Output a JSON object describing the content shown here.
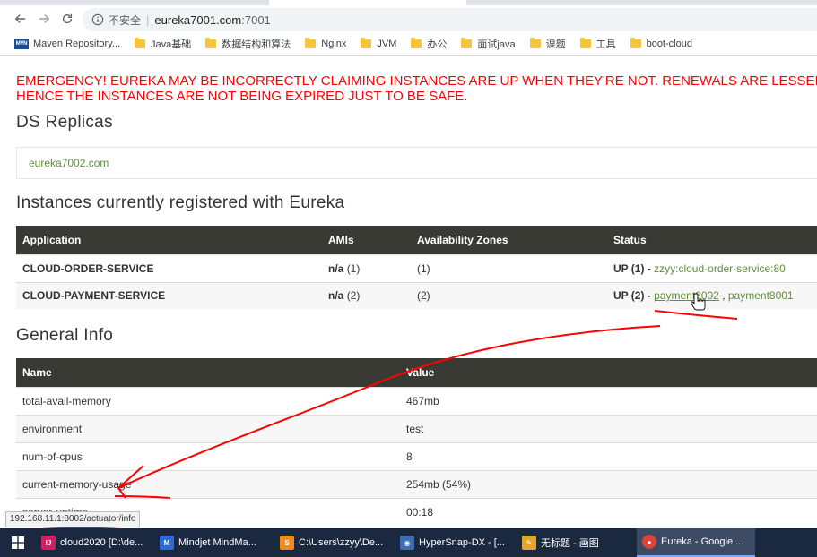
{
  "browser": {
    "omnibox": {
      "security_label": "不安全",
      "url_host": "eureka7001.com",
      "url_port": ":7001"
    },
    "bookmarks": [
      {
        "label": "Maven Repository...",
        "icon": "maven-logo"
      },
      {
        "label": "Java基础",
        "icon": "folder-icon"
      },
      {
        "label": "数据结构和算法",
        "icon": "folder-icon"
      },
      {
        "label": "Nginx",
        "icon": "folder-icon"
      },
      {
        "label": "JVM",
        "icon": "folder-icon"
      },
      {
        "label": "办公",
        "icon": "folder-icon"
      },
      {
        "label": "面试java",
        "icon": "folder-icon"
      },
      {
        "label": "课题",
        "icon": "folder-icon"
      },
      {
        "label": "工具",
        "icon": "folder-icon"
      },
      {
        "label": "boot-cloud",
        "icon": "folder-icon"
      }
    ],
    "status_url": "192.168.11.1:8002/actuator/info"
  },
  "page": {
    "emergency_line1": "EMERGENCY! EUREKA MAY BE INCORRECTLY CLAIMING INSTANCES ARE UP WHEN THEY'RE NOT. RENEWALS ARE LESSER",
    "emergency_line2": "HENCE THE INSTANCES ARE NOT BEING EXPIRED JUST TO BE SAFE.",
    "ds_replicas_title": "DS Replicas",
    "replica": "eureka7002.com",
    "instances_title": "Instances currently registered with Eureka",
    "instances_headers": [
      "Application",
      "AMIs",
      "Availability Zones",
      "Status"
    ],
    "instances": [
      {
        "application": "CLOUD-ORDER-SERVICE",
        "amis_value": "n/a",
        "amis_count": "(1)",
        "zones": "(1)",
        "status_prefix": "UP (1) - ",
        "links": [
          "zzyy:cloud-order-service:80"
        ]
      },
      {
        "application": "CLOUD-PAYMENT-SERVICE",
        "amis_value": "n/a",
        "amis_count": "(2)",
        "zones": "(2)",
        "status_prefix": "UP (2) - ",
        "links": [
          "payment8002",
          "payment8001"
        ]
      }
    ],
    "general_title": "General Info",
    "general_headers": [
      "Name",
      "Value"
    ],
    "general_info": [
      {
        "name": "total-avail-memory",
        "value": "467mb"
      },
      {
        "name": "environment",
        "value": "test"
      },
      {
        "name": "num-of-cpus",
        "value": "8"
      },
      {
        "name": "current-memory-usage",
        "value": "254mb (54%)"
      },
      {
        "name": "server-uptime",
        "value": "00:18"
      }
    ]
  },
  "taskbar": [
    {
      "label": "cloud2020 [D:\\de...",
      "icon": "intellij-icon",
      "color": "#d21f5d"
    },
    {
      "label": "Mindjet MindMa...",
      "icon": "mindjet-icon",
      "color": "#2e6bd6"
    },
    {
      "label": "C:\\Users\\zzyy\\De...",
      "icon": "sublime-icon",
      "color": "#f08c1e"
    },
    {
      "label": "HyperSnap-DX - [...",
      "icon": "camera-icon",
      "color": "#3b6fb0"
    },
    {
      "label": "无标题 - 画图",
      "icon": "paint-icon",
      "color": "#e0a52a"
    },
    {
      "label": "Eureka - Google ...",
      "icon": "chrome-icon",
      "color": "#db4437"
    }
  ],
  "colors": {
    "emergency": "#ff0000",
    "link": "#5f8d3a",
    "table_header": "#3a3a35",
    "annotation": "#ff0000",
    "taskbar": "#1b2940"
  }
}
